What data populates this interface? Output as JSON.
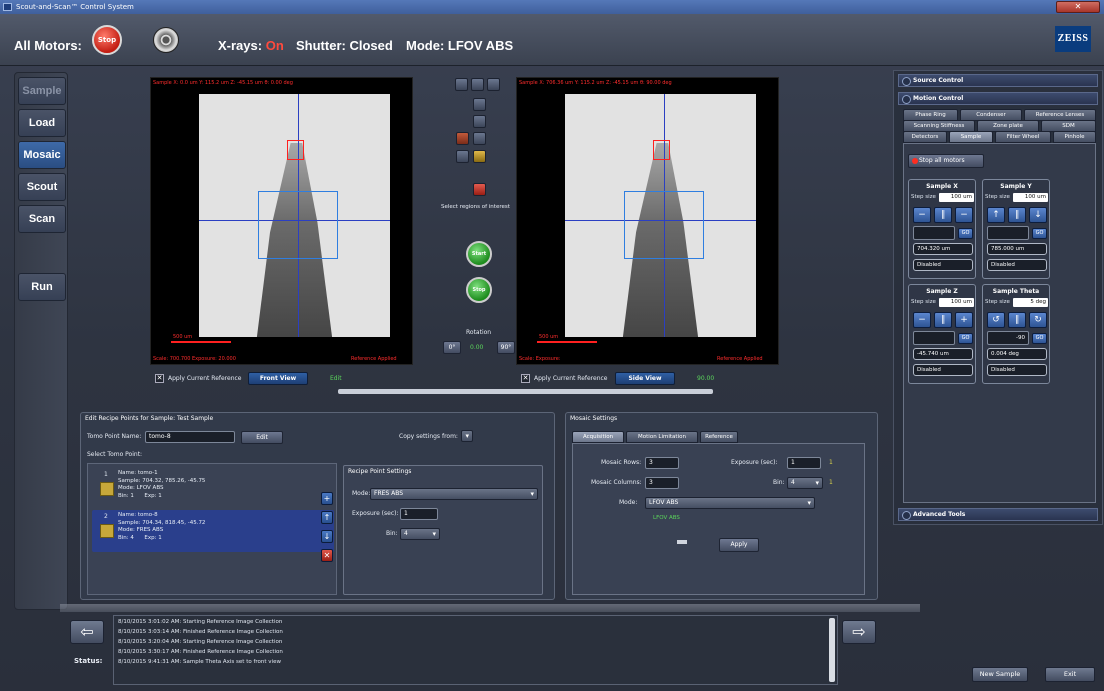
{
  "window": {
    "title": "Scout-and-Scan™ Control System"
  },
  "header": {
    "all_motors_label": "All Motors:",
    "stop_label": "Stop",
    "xrays_label": "X-rays:",
    "xrays_state": "On",
    "shutter_label": "Shutter: Closed",
    "mode_label": "Mode: LFOV ABS",
    "logo_text": "ZEISS"
  },
  "leftnav": {
    "items": [
      {
        "label": "Sample"
      },
      {
        "label": "Load"
      },
      {
        "label": "Mosaic"
      },
      {
        "label": "Scout"
      },
      {
        "label": "Scan"
      },
      {
        "label": "Run"
      }
    ]
  },
  "views": {
    "front": {
      "header_text": "Sample X: 0.0 um  Y: 115.2 um  Z: -45.15 um  θ: 0.00 deg",
      "scale_text": "500 um",
      "footer_left": "Scale: 700.700  Exposure: 20.000",
      "footer_right": "Reference Applied",
      "apply_label": "Apply Current Reference",
      "view_button": "Front View",
      "status": "Edit"
    },
    "side": {
      "header_text": "Sample X: 706.36 um  Y: 115.2 um  Z: -45.15 um  θ: 90.00 deg",
      "scale_text": "500 um",
      "footer_left": "Scale:  Exposure:",
      "footer_right": "Reference Applied",
      "apply_label": "Apply Current Reference",
      "view_button": "Side View",
      "status": "90.00"
    }
  },
  "center_tools": {
    "select_roi_label": "Select regions of interest",
    "start_label": "Start",
    "stop_label": "Stop",
    "rotation_label": "Rotation",
    "rotation_left": "0°",
    "rotation_value": "0.00",
    "rotation_right": "90°"
  },
  "recipe_panel": {
    "title": "Edit Recipe Points for Sample: Test Sample",
    "tomo_name_label": "Tomo Point Name:",
    "tomo_name_value": "tomo-8",
    "edit_button": "Edit",
    "copy_settings_label": "Copy settings from:",
    "select_points_label": "Select Tomo Point:",
    "tomo_points": [
      {
        "num": "1",
        "text": "Name: tomo-1\nSample: 704.32, 785.26, -45.75\nMode: LFOV ABS\nBin: 1      Exp: 1"
      },
      {
        "num": "2",
        "text": "Name: tomo-8\nSample: 704.34, 818.45, -45.72\nMode: FRES ABS\nBin: 4      Exp: 1"
      }
    ],
    "recipe_settings_title": "Recipe Point Settings",
    "mode_label": "Mode:",
    "mode_value": "FRES ABS",
    "exposure_label": "Exposure (sec):",
    "exposure_value": "1",
    "bin_label": "Bin:",
    "bin_value": "4"
  },
  "mosaic_panel": {
    "title": "Mosaic Settings",
    "tabs": [
      "Acquisition",
      "Motion Limitation",
      "Reference"
    ],
    "rows_label": "Mosaic Rows:",
    "rows_value": "3",
    "columns_label": "Mosaic Columns:",
    "columns_value": "3",
    "exposure_label": "Exposure (sec):",
    "exposure_value": "1",
    "bin_label": "Bin:",
    "bin_value": "4",
    "mode_label": "Mode:",
    "mode_value": "LFOV ABS",
    "mode_note": "LFOV ABS",
    "apply_button": "Apply",
    "hint1": "1",
    "hint2": "1"
  },
  "right_panel": {
    "source_control": "Source Control",
    "motion_control": "Motion Control",
    "advanced_tools": "Advanced Tools",
    "tabs_row1": [
      "Phase Ring",
      "Condenser",
      "Reference Lenses"
    ],
    "tabs_row2": [
      "Scanning Stiffness",
      "Zone plate",
      "SDM"
    ],
    "tabs_row3": [
      "Detectors",
      "Sample",
      "Filter Wheel",
      "Pinhole"
    ],
    "stop_all_label": "Stop all motors",
    "step_size_label": "Step size",
    "go_label": "GO",
    "axes": [
      {
        "title": "Sample X",
        "step": "100 um",
        "position": "704.320 um",
        "state": "Disabled"
      },
      {
        "title": "Sample Y",
        "step": "100 um",
        "position": "785.000 um",
        "state": "Disabled"
      },
      {
        "title": "Sample Z",
        "step": "100 um",
        "position": "-45.740 um",
        "state": "Disabled"
      },
      {
        "title": "Sample Theta",
        "step": "5 deg",
        "position": "0.004 deg",
        "state": "Disabled",
        "go_value": "-90"
      }
    ]
  },
  "status": {
    "label": "Status:",
    "lines": [
      "8/10/2015 3:01:02 AM: Starting Reference Image Collection",
      "8/10/2015 3:03:14 AM: Finished Reference Image Collection",
      "8/10/2015 3:20:04 AM: Starting Reference Image Collection",
      "8/10/2015 3:30:17 AM: Finished Reference Image Collection",
      "8/10/2015 9:41:31 AM: Sample Theta Axis set to front view"
    ]
  },
  "bottom": {
    "new_sample": "New Sample",
    "exit": "Exit"
  }
}
